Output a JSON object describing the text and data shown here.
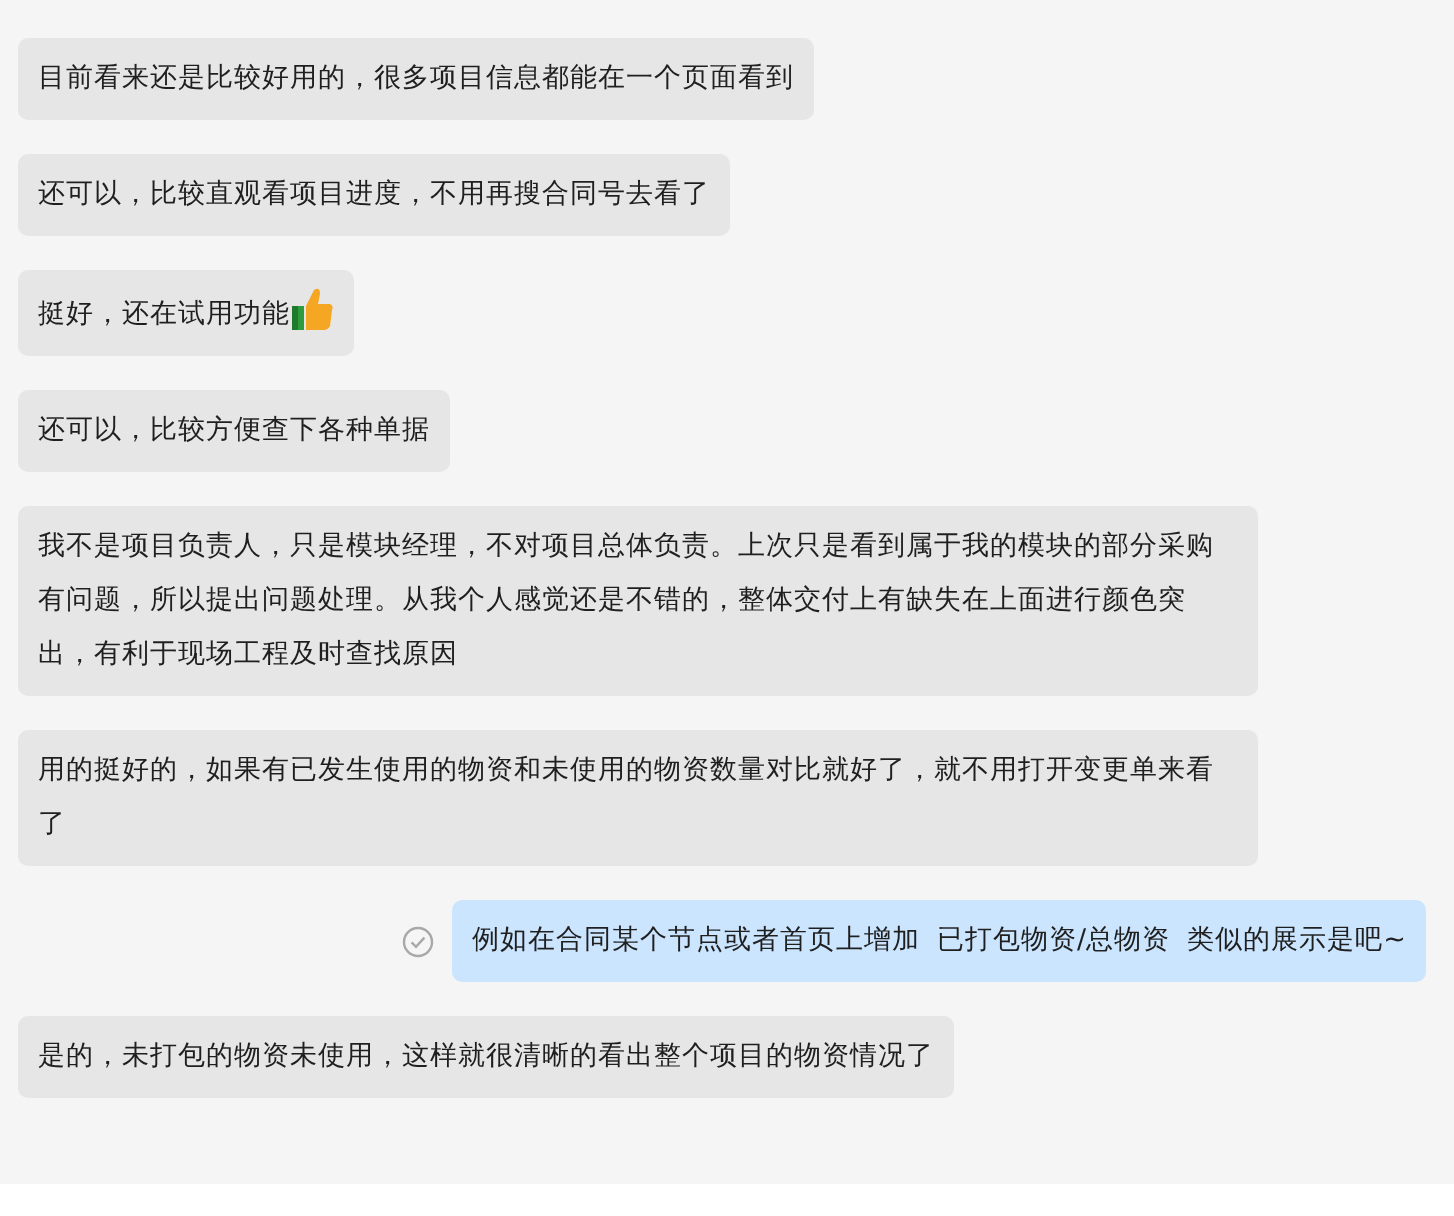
{
  "messages": [
    {
      "kind": "received",
      "text": "目前看来还是比较好用的，很多项目信息都能在一个页面看到",
      "trailing_icon": false,
      "read": false
    },
    {
      "kind": "received",
      "text": "还可以，比较直观看项目进度，不用再搜合同号去看了",
      "trailing_icon": false,
      "read": false
    },
    {
      "kind": "received",
      "text": "挺好，还在试用功能",
      "trailing_icon": true,
      "read": false
    },
    {
      "kind": "received",
      "text": "还可以，比较方便查下各种单据",
      "trailing_icon": false,
      "read": false
    },
    {
      "kind": "received",
      "text": "我不是项目负责人，只是模块经理，不对项目总体负责。上次只是看到属于我的模块的部分采购有问题，所以提出问题处理。从我个人感觉还是不错的，整体交付上有缺失在上面进行颜色突出，有利于现场工程及时查找原因",
      "trailing_icon": false,
      "read": false
    },
    {
      "kind": "received",
      "text": "用的挺好的，如果有已发生使用的物资和未使用的物资数量对比就好了，就不用打开变更单来看了",
      "trailing_icon": false,
      "read": false
    },
    {
      "kind": "sent",
      "text": "例如在合同某个节点或者首页上增加  已打包物资/总物资  类似的展示是吧~",
      "trailing_icon": false,
      "read": true
    },
    {
      "kind": "received",
      "text": "是的，未打包的物资未使用，这样就很清晰的看出整个项目的物资情况了",
      "trailing_icon": false,
      "read": false
    }
  ]
}
